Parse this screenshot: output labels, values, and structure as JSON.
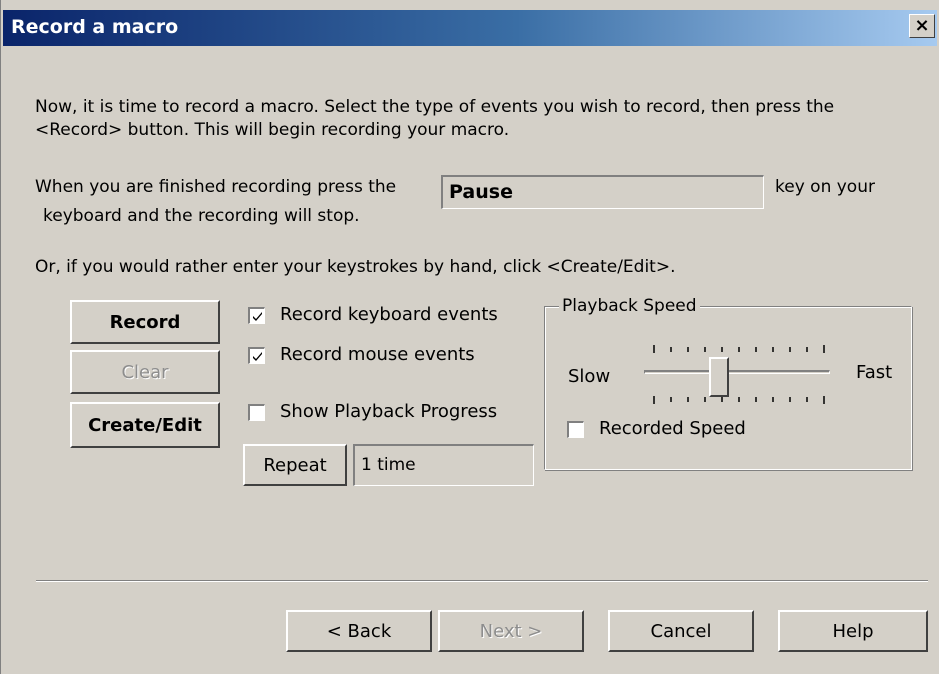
{
  "window": {
    "title": "Record a macro",
    "close_glyph": "×"
  },
  "instructions": {
    "line1": "Now, it is time to record a macro.  Select the type of events you wish to record, then press the",
    "line2": "<Record> button.  This will begin recording your macro.",
    "stop_key_prefix": "When you are finished recording press the",
    "stop_key_value": "Pause",
    "stop_key_suffix": "key on your",
    "stop_key_line2": "keyboard and the recording will stop.",
    "manual_hint": "Or, if you would rather enter your keystrokes by hand, click <Create/Edit>."
  },
  "buttons": {
    "record": "Record",
    "clear": "Clear",
    "create_edit": "Create/Edit",
    "repeat": "Repeat"
  },
  "options": {
    "record_keyboard": {
      "label": "Record keyboard events",
      "checked": true
    },
    "record_mouse": {
      "label": "Record mouse events",
      "checked": true
    },
    "show_progress": {
      "label": "Show Playback Progress",
      "checked": false
    }
  },
  "repeat_value": "1 time",
  "playback": {
    "group_label": "Playback Speed",
    "slow_label": "Slow",
    "fast_label": "Fast",
    "slider_position": 0.33,
    "recorded_speed": {
      "label": "Recorded Speed",
      "checked": false
    }
  },
  "nav": {
    "back": "< Back",
    "next": "Next >",
    "cancel": "Cancel",
    "help": "Help"
  },
  "colors": {
    "face": "#d4d0c8",
    "title_start": "#0a246a",
    "title_end": "#a6caf0",
    "disabled_text": "#8d8d8d"
  },
  "icons": {
    "close": "close-icon",
    "check": "checkmark-icon"
  }
}
